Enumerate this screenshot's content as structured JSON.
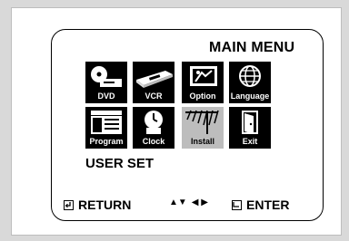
{
  "menu": {
    "title": "MAIN MENU",
    "section_label": "USER SET",
    "items": [
      {
        "label": "DVD",
        "icon": "dvd-player-icon",
        "selected": false
      },
      {
        "label": "VCR",
        "icon": "vcr-icon",
        "selected": false
      },
      {
        "label": "Option",
        "icon": "option-icon",
        "selected": false
      },
      {
        "label": "Language",
        "icon": "globe-icon",
        "selected": false
      },
      {
        "label": "Program",
        "icon": "calendar-icon",
        "selected": false
      },
      {
        "label": "Clock",
        "icon": "clock-icon",
        "selected": false
      },
      {
        "label": "Install",
        "icon": "antenna-icon",
        "selected": true
      },
      {
        "label": "Exit",
        "icon": "exit-door-icon",
        "selected": false
      }
    ]
  },
  "footer": {
    "return_label": "RETURN",
    "nav_glyphs": {
      "up_down": "▲▼",
      "left_right": "◀ ▶"
    },
    "enter_label": "ENTER"
  },
  "colors": {
    "tile": "#000000",
    "selected_tile": "#bdbdbd",
    "background": "#ffffff"
  }
}
